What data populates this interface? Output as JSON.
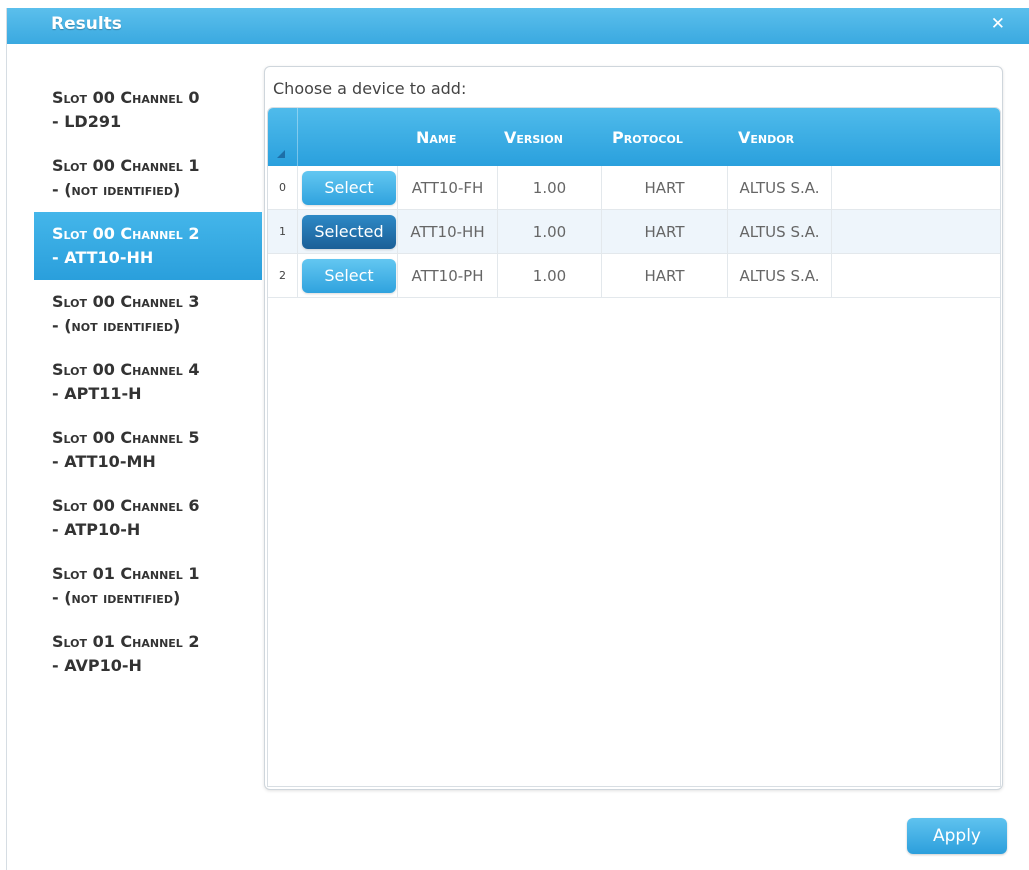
{
  "dialog": {
    "title": "Results",
    "close_glyph": "✕",
    "apply_label": "Apply"
  },
  "sidebar": {
    "items": [
      {
        "line1": "Slot 00 Channel 0",
        "line2": "- LD291",
        "active": false
      },
      {
        "line1": "Slot 00 Channel 1",
        "line2": "- (not identified)",
        "active": false
      },
      {
        "line1": "Slot 00 Channel 2",
        "line2": "- ATT10-HH",
        "active": true
      },
      {
        "line1": "Slot 00 Channel 3",
        "line2": "- (not identified)",
        "active": false
      },
      {
        "line1": "Slot 00 Channel 4",
        "line2": "- APT11-H",
        "active": false
      },
      {
        "line1": "Slot 00 Channel 5",
        "line2": "- ATT10-MH",
        "active": false
      },
      {
        "line1": "Slot 00 Channel 6",
        "line2": "- ATP10-H",
        "active": false
      },
      {
        "line1": "Slot 01 Channel 1",
        "line2": "- (not identified)",
        "active": false
      },
      {
        "line1": "Slot 01 Channel 2",
        "line2": "- AVP10-H",
        "active": false
      }
    ]
  },
  "panel": {
    "prompt": "Choose a device to add:",
    "columns": {
      "name": "Name",
      "version": "Version",
      "protocol": "Protocol",
      "vendor": "Vendor"
    },
    "rows": [
      {
        "index": "0",
        "button": "Select",
        "selected": false,
        "name": "ATT10-FH",
        "version": "1.00",
        "protocol": "HART",
        "vendor": "ALTUS S.A."
      },
      {
        "index": "1",
        "button": "Selected",
        "selected": true,
        "name": "ATT10-HH",
        "version": "1.00",
        "protocol": "HART",
        "vendor": "ALTUS S.A."
      },
      {
        "index": "2",
        "button": "Select",
        "selected": false,
        "name": "ATT10-PH",
        "version": "1.00",
        "protocol": "HART",
        "vendor": "ALTUS S.A."
      }
    ]
  },
  "colors": {
    "accent": "#3aa9e0",
    "selected_button": "#1b5f97"
  }
}
